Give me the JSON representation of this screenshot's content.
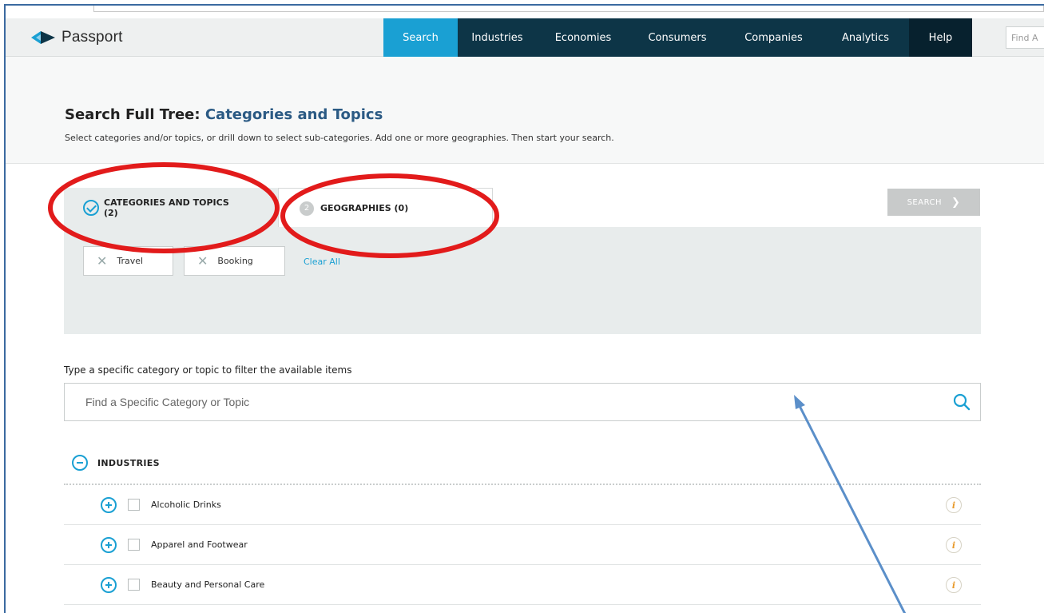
{
  "app": {
    "name": "Passport"
  },
  "nav": {
    "items": [
      {
        "label": "Search",
        "active": true
      },
      {
        "label": "Industries"
      },
      {
        "label": "Economies"
      },
      {
        "label": "Consumers"
      },
      {
        "label": "Companies"
      },
      {
        "label": "Analytics"
      },
      {
        "label": "Help"
      }
    ],
    "find_placeholder": "Find A"
  },
  "header": {
    "title_prefix": "Search Full Tree:",
    "title_accent": "Categories and Topics",
    "subtitle": "Select categories and/or topics, or drill down to select sub-categories. Add one or more geographies. Then start your search."
  },
  "tabs": {
    "categories": {
      "label": "CATEGORIES AND TOPICS",
      "count": "(2)"
    },
    "geographies": {
      "step": "2",
      "label": "GEOGRAPHIES (0)"
    }
  },
  "search_button": {
    "label": "SEARCH",
    "chevron": "❯"
  },
  "selected": {
    "chips": [
      {
        "label": "Travel"
      },
      {
        "label": "Booking"
      }
    ],
    "clear_all": "Clear All",
    "remove_glyph": "✕"
  },
  "filter": {
    "label": "Type a specific category or topic to filter the available items",
    "placeholder": "Find a Specific Category or Topic"
  },
  "tree": {
    "section": "INDUSTRIES",
    "info_glyph": "i",
    "items": [
      {
        "label": "Alcoholic Drinks"
      },
      {
        "label": "Apparel and Footwear"
      },
      {
        "label": "Beauty and Personal Care"
      }
    ]
  },
  "colors": {
    "accent": "#1aa0d3",
    "nav_dark": "#0d3547",
    "annotation_red": "#e21b1b",
    "annotation_arrow": "#5b8fc9"
  }
}
